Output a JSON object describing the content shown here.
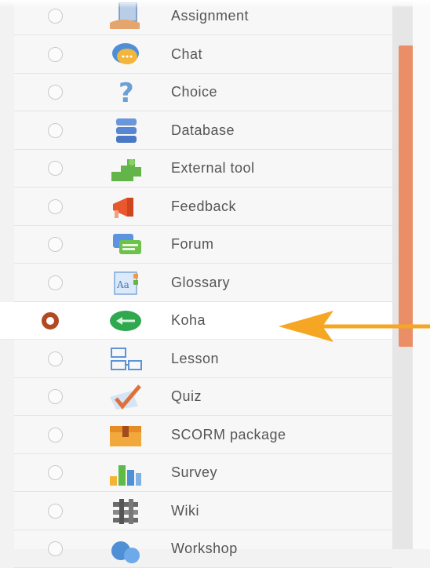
{
  "activities": [
    {
      "label": "Assignment",
      "icon": "assignment-icon",
      "selected": false
    },
    {
      "label": "Chat",
      "icon": "chat-icon",
      "selected": false
    },
    {
      "label": "Choice",
      "icon": "question-icon",
      "selected": false
    },
    {
      "label": "Database",
      "icon": "database-icon",
      "selected": false
    },
    {
      "label": "External tool",
      "icon": "puzzle-icon",
      "selected": false
    },
    {
      "label": "Feedback",
      "icon": "megaphone-icon",
      "selected": false
    },
    {
      "label": "Forum",
      "icon": "forum-icon",
      "selected": false
    },
    {
      "label": "Glossary",
      "icon": "glossary-icon",
      "selected": false
    },
    {
      "label": "Koha",
      "icon": "koha-icon",
      "selected": true
    },
    {
      "label": "Lesson",
      "icon": "lesson-icon",
      "selected": false
    },
    {
      "label": "Quiz",
      "icon": "quiz-icon",
      "selected": false
    },
    {
      "label": "SCORM package",
      "icon": "scorm-package-icon",
      "selected": false
    },
    {
      "label": "Survey",
      "icon": "survey-icon",
      "selected": false
    },
    {
      "label": "Wiki",
      "icon": "wiki-icon",
      "selected": false
    },
    {
      "label": "Workshop",
      "icon": "workshop-icon",
      "selected": false
    }
  ],
  "colors": {
    "selected_radio": "#b14a22",
    "scrollbar_thumb": "#e98e66",
    "arrow": "#f5a623"
  }
}
